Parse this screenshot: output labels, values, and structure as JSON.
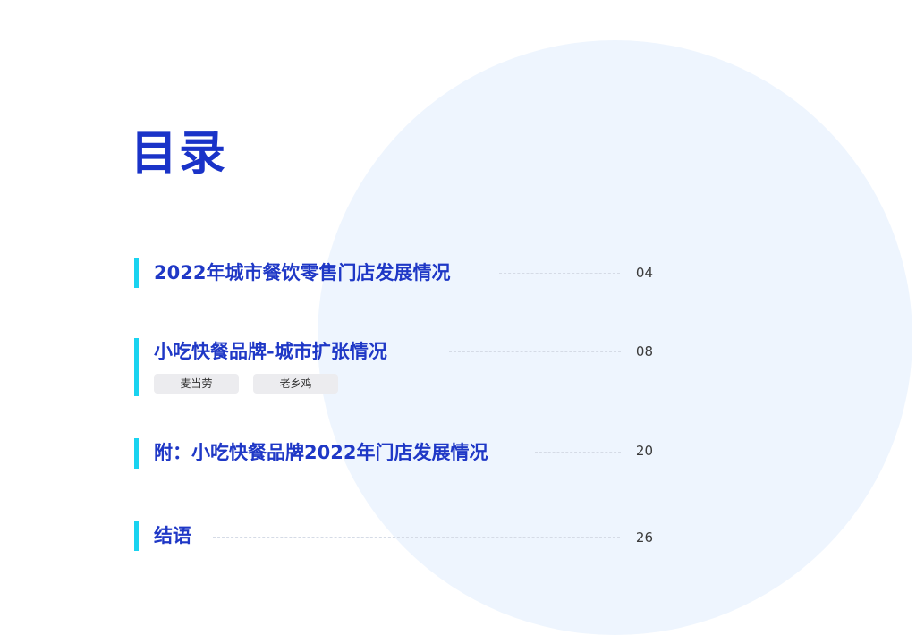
{
  "page": {
    "title": "目录"
  },
  "toc": [
    {
      "heading": "2022年城市餐饮零售门店发展情况",
      "page": "04"
    },
    {
      "heading": "小吃快餐品牌-城市扩张情况",
      "page": "08",
      "tags": [
        "麦当劳",
        "老乡鸡"
      ]
    },
    {
      "heading": "附：小吃快餐品牌2022年门店发展情况",
      "page": "20"
    },
    {
      "heading": "结语",
      "page": "26"
    }
  ],
  "colors": {
    "accent_blue": "#1a33c8",
    "bar_cyan": "#19d3f0",
    "circle_bg": "#eef5fe"
  }
}
